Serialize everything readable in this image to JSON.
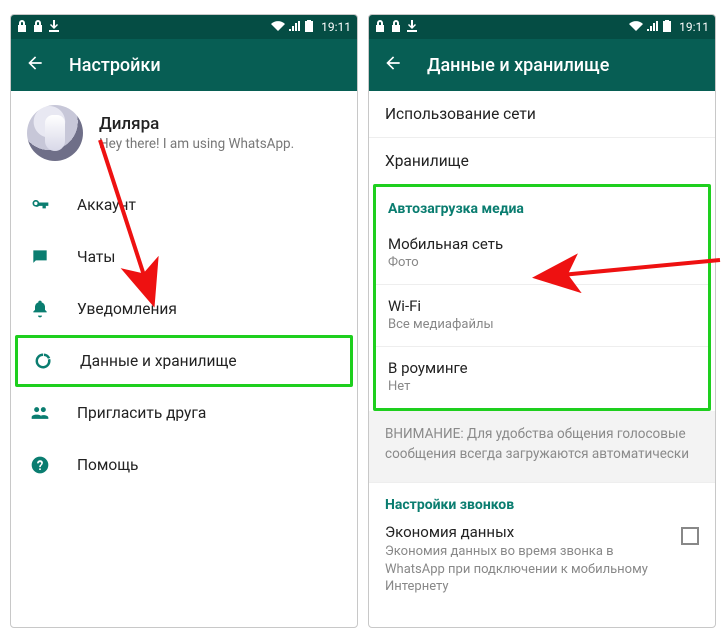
{
  "status": {
    "time": "19:11"
  },
  "left": {
    "title": "Настройки",
    "profile": {
      "name": "Диляра",
      "status": "Hey there! I am using WhatsApp."
    },
    "items": [
      {
        "icon": "key-icon",
        "label": "Аккаунт"
      },
      {
        "icon": "chat-icon",
        "label": "Чаты"
      },
      {
        "icon": "bell-icon",
        "label": "Уведомления"
      },
      {
        "icon": "data-usage-icon",
        "label": "Данные и хранилище"
      },
      {
        "icon": "people-icon",
        "label": "Пригласить друга"
      },
      {
        "icon": "help-icon",
        "label": "Помощь"
      }
    ]
  },
  "right": {
    "title": "Данные и хранилище",
    "rows": {
      "network_usage": "Использование сети",
      "storage": "Хранилище"
    },
    "autoload": {
      "header": "Автозагрузка медиа",
      "mobile": {
        "label": "Мобильная сеть",
        "value": "Фото"
      },
      "wifi": {
        "label": "Wi-Fi",
        "value": "Все медиафайлы"
      },
      "roaming": {
        "label": "В роуминге",
        "value": "Нет"
      }
    },
    "notice": "ВНИМАНИЕ: Для удобства общения голосовые сообщения всегда загружаются автоматически",
    "calls": {
      "header": "Настройки звонков",
      "economy": {
        "label": "Экономия данных",
        "desc": "Экономия данных во время звонка в WhatsApp при подключении к мобильному Интернету"
      }
    }
  }
}
